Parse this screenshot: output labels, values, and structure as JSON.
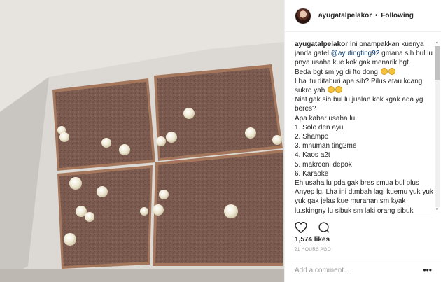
{
  "post": {
    "username": "ayugatalpelakor",
    "separator": "•",
    "follow_status": "Following",
    "likes": "1,574 likes",
    "timestamp": "21 HOURS AGO",
    "comment_placeholder": "Add a comment...",
    "more_icon": "ellipsis-icon",
    "like_icon": "heart-icon",
    "comment_icon": "speech-bubble-icon"
  },
  "caption": {
    "author": "ayugatalpelakor",
    "text_1": " Ini pnampakkan kuenya janda gatel ",
    "mention": "@ayutingting92",
    "text_2": " gmana sih bul lu pnya usaha kue kok gak menarik bgt.",
    "line_beda": "Beda bgt sm yg di fto dong",
    "line_lha": "Lha itu ditaburi apa sih? Pilus atau kcang sukro yah",
    "line_niat": "Niat gak sih bul lu jualan kok kgak ada yg beres?",
    "line_apa": "Apa kabar usaha lu",
    "list": [
      "1. Solo den ayu",
      "2. Shampo",
      "3. mnuman ting2me",
      "4. Kaos a2t",
      "5. makrconi depok",
      "6. Karaoke"
    ],
    "line_eh": "Eh usaha lu pda gak bres smua bul plus Anyep lg. Lha ini dtmbah lagi kuemu yuk yuk yuk gak jelas kue murahan sm kyak lu.skingny lu sibuk sm laki orang sibuk gimmik sibuk goyang ngangkang goyang"
  },
  "colors": {
    "mention": "#003569",
    "cake": "#7a5a4e",
    "crust": "#a1785f",
    "topping": "#f4efdf"
  }
}
